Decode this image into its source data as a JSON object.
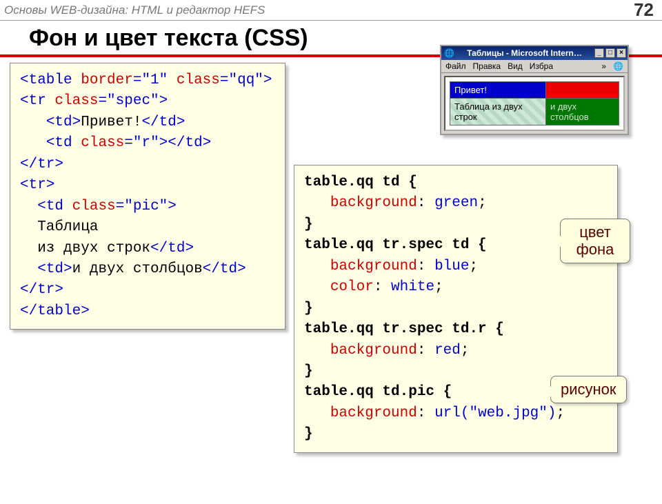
{
  "header": {
    "breadcrumb": "Основы WEB-дизайна: HTML и редактор HEFS",
    "page_number": "72"
  },
  "title": "Фон и цвет текста (CSS)",
  "html_code_lines": [
    [
      [
        "tag",
        "<table "
      ],
      [
        "attr",
        "border"
      ],
      [
        "tag",
        "="
      ],
      [
        "val",
        "\"1\" "
      ],
      [
        "attr",
        "class"
      ],
      [
        "tag",
        "="
      ],
      [
        "val",
        "\"qq\""
      ],
      [
        "tag",
        ">"
      ]
    ],
    [
      [
        "tag",
        "<tr "
      ],
      [
        "attr",
        "class"
      ],
      [
        "tag",
        "="
      ],
      [
        "val",
        "\"spec\""
      ],
      [
        "tag",
        ">"
      ]
    ],
    [
      [
        "txt",
        "   "
      ],
      [
        "tag",
        "<td>"
      ],
      [
        "txt",
        "Привет!"
      ],
      [
        "tag",
        "</td>"
      ]
    ],
    [
      [
        "txt",
        "   "
      ],
      [
        "tag",
        "<td "
      ],
      [
        "attr",
        "class"
      ],
      [
        "tag",
        "="
      ],
      [
        "val",
        "\"r\""
      ],
      [
        "tag",
        "></td>"
      ]
    ],
    [
      [
        "tag",
        "</tr>"
      ]
    ],
    [
      [
        "tag",
        "<tr>"
      ]
    ],
    [
      [
        "txt",
        "  "
      ],
      [
        "tag",
        "<td "
      ],
      [
        "attr",
        "class"
      ],
      [
        "tag",
        "="
      ],
      [
        "val",
        "\"pic\""
      ],
      [
        "tag",
        ">"
      ]
    ],
    [
      [
        "txt",
        "  Таблица"
      ]
    ],
    [
      [
        "txt",
        "  из двух строк"
      ],
      [
        "tag",
        "</td>"
      ]
    ],
    [
      [
        "txt",
        "  "
      ],
      [
        "tag",
        "<td>"
      ],
      [
        "txt",
        "и двух столбцов"
      ],
      [
        "tag",
        "</td>"
      ]
    ],
    [
      [
        "tag",
        "</tr>"
      ]
    ],
    [
      [
        "tag",
        "</table>"
      ]
    ]
  ],
  "css_code_lines": [
    [
      [
        "sel",
        "table.qq td { "
      ]
    ],
    [
      [
        "txt",
        "   "
      ],
      [
        "prop",
        "background"
      ],
      [
        "txt",
        ": "
      ],
      [
        "cssv",
        "green"
      ],
      [
        "txt",
        ";"
      ]
    ],
    [
      [
        "sel",
        "}"
      ]
    ],
    [
      [
        "sel",
        "table.qq tr.spec td {"
      ]
    ],
    [
      [
        "txt",
        "   "
      ],
      [
        "prop",
        "background"
      ],
      [
        "txt",
        ": "
      ],
      [
        "cssv",
        "blue"
      ],
      [
        "txt",
        ";"
      ]
    ],
    [
      [
        "txt",
        "   "
      ],
      [
        "prop",
        "color"
      ],
      [
        "txt",
        ": "
      ],
      [
        "cssv",
        "white"
      ],
      [
        "txt",
        ";"
      ]
    ],
    [
      [
        "sel",
        "}"
      ]
    ],
    [
      [
        "sel",
        "table.qq tr.spec td.r {"
      ]
    ],
    [
      [
        "txt",
        "   "
      ],
      [
        "prop",
        "background"
      ],
      [
        "txt",
        ": "
      ],
      [
        "cssv",
        "red"
      ],
      [
        "txt",
        ";"
      ]
    ],
    [
      [
        "sel",
        "}"
      ]
    ],
    [
      [
        "sel",
        "table.qq td.pic {"
      ]
    ],
    [
      [
        "txt",
        "   "
      ],
      [
        "prop",
        "background"
      ],
      [
        "txt",
        ": "
      ],
      [
        "cssv",
        "url(\"web.jpg\")"
      ],
      [
        "txt",
        ";"
      ]
    ],
    [
      [
        "sel",
        "}"
      ]
    ]
  ],
  "browser": {
    "title": "Таблицы - Microsoft Intern…",
    "menu": [
      "Файл",
      "Правка",
      "Вид",
      "Избра"
    ],
    "cells": {
      "hello": "Привет!",
      "row2a": "Таблица из двух строк",
      "row2b": "и двух столбцов"
    }
  },
  "callouts": {
    "bgcolor": "цвет фона",
    "picture": "рисунок"
  }
}
